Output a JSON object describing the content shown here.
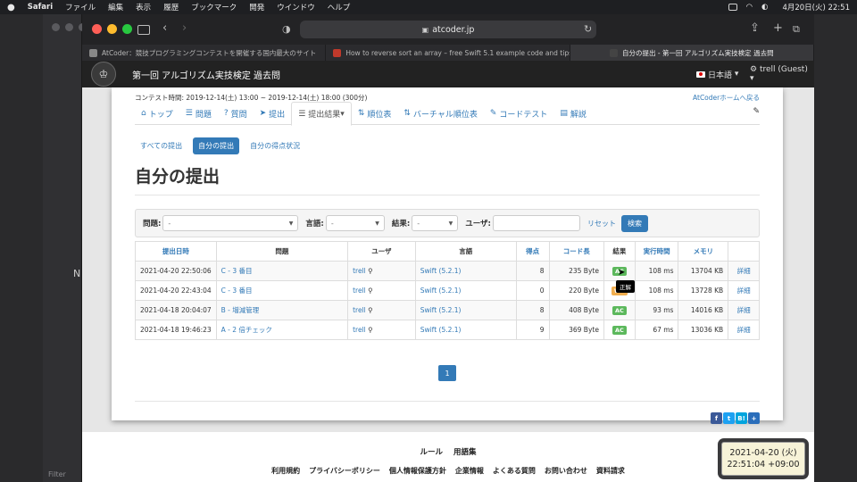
{
  "menubar": {
    "app": "Safari",
    "items": [
      "ファイル",
      "編集",
      "表示",
      "履歴",
      "ブックマーク",
      "開発",
      "ウインドウ",
      "ヘルプ"
    ],
    "datetime": "4月20日(火)  22:51"
  },
  "bg_window": {
    "letter": "N",
    "filter": "Filter"
  },
  "browser": {
    "url": "atcoder.jp",
    "tabs": [
      {
        "title": "AtCoder：競技プログラミングコンテストを開催する国内最大のサイト",
        "favicon_color": "#888888"
      },
      {
        "title": "How to reverse sort an array – free Swift 5.1 example code and tips",
        "favicon_color": "#c0392b"
      },
      {
        "title": "自分の提出 - 第一回 アルゴリズム実技検定 過去問",
        "favicon_color": "#444444"
      }
    ]
  },
  "navbar": {
    "contest_title": "第一回 アルゴリズム実技検定 過去問",
    "language": "日本語",
    "user": "trell (Guest)"
  },
  "contest": {
    "time": "コンテスト時間: 2019-12-14(土) 13:00 ~ 2019-12-14(土) 18:00 (300分)",
    "home_link": "AtCoderホームへ戻る"
  },
  "tabs": [
    {
      "label": "トップ",
      "icon": "home-icon",
      "glyph": "⌂"
    },
    {
      "label": "問題",
      "icon": "list-icon",
      "glyph": "☰"
    },
    {
      "label": "質問",
      "icon": "question-icon",
      "glyph": "?"
    },
    {
      "label": "提出",
      "icon": "send-icon",
      "glyph": "➤"
    },
    {
      "label": "提出結果",
      "icon": "list-icon",
      "glyph": "☰",
      "active": true
    },
    {
      "label": "順位表",
      "icon": "sort-icon",
      "glyph": "⇅"
    },
    {
      "label": "バーチャル順位表",
      "icon": "sort-icon",
      "glyph": "⇅"
    },
    {
      "label": "コードテスト",
      "icon": "wrench-icon",
      "glyph": "✎"
    },
    {
      "label": "解説",
      "icon": "book-icon",
      "glyph": "▤"
    }
  ],
  "subtabs": [
    {
      "label": "すべての提出",
      "active": false
    },
    {
      "label": "自分の提出",
      "active": true
    },
    {
      "label": "自分の得点状況",
      "active": false
    }
  ],
  "heading": "自分の提出",
  "filters": {
    "problem_label": "問題:",
    "problem_value": "-",
    "language_label": "言語:",
    "language_value": "-",
    "result_label": "結果:",
    "result_value": "-",
    "user_label": "ユーザ:",
    "user_value": "",
    "reset": "リセット",
    "search": "検索"
  },
  "table": {
    "headers": [
      "提出日時",
      "問題",
      "ユーザ",
      "言語",
      "得点",
      "コード長",
      "結果",
      "実行時間",
      "メモリ",
      ""
    ],
    "rows": [
      {
        "time": "2021-04-20 22:50:06",
        "problem": "C - 3 番目",
        "user": "trell",
        "lang": "Swift (5.2.1)",
        "score": "8",
        "length": "235 Byte",
        "status": "AC",
        "exec": "108 ms",
        "memory": "13704 KB",
        "detail": "詳細"
      },
      {
        "time": "2021-04-20 22:43:04",
        "problem": "C - 3 番目",
        "user": "trell",
        "lang": "Swift (5.2.1)",
        "score": "0",
        "length": "220 Byte",
        "status": "WA",
        "exec": "108 ms",
        "memory": "13728 KB",
        "detail": "詳細"
      },
      {
        "time": "2021-04-18 20:04:07",
        "problem": "B - 増減管理",
        "user": "trell",
        "lang": "Swift (5.2.1)",
        "score": "8",
        "length": "408 Byte",
        "status": "AC",
        "exec": "93 ms",
        "memory": "14016 KB",
        "detail": "詳細"
      },
      {
        "time": "2021-04-18 19:46:23",
        "problem": "A - 2 倍チェック",
        "user": "trell",
        "lang": "Swift (5.2.1)",
        "score": "9",
        "length": "369 Byte",
        "status": "AC",
        "exec": "67 ms",
        "memory": "13036 KB",
        "detail": "詳細"
      }
    ]
  },
  "tooltip": "正解",
  "pagination": {
    "current": "1"
  },
  "social": [
    {
      "glyph": "f",
      "color": "#3b5998",
      "icon": "facebook-icon"
    },
    {
      "glyph": "t",
      "color": "#1da1f2",
      "icon": "twitter-icon"
    },
    {
      "glyph": "B!",
      "color": "#00a4de",
      "icon": "hatena-icon"
    },
    {
      "glyph": "+",
      "color": "#2a6ebb",
      "icon": "share-plus-icon"
    }
  ],
  "footer": {
    "row1": [
      "ルール",
      "用語集"
    ],
    "row2": [
      "利用規約",
      "プライバシーポリシー",
      "個人情報保護方針",
      "企業情報",
      "よくある質問",
      "お問い合わせ",
      "資料請求"
    ]
  },
  "overlay": {
    "date": "2021-04-20 (火)",
    "time": "22:51:04 +09:00"
  }
}
